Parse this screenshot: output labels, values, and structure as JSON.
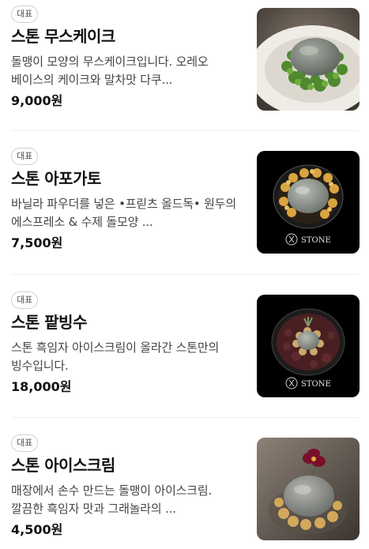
{
  "menu": {
    "items": [
      {
        "badge": "대표",
        "name": "스톤 무스케이크",
        "description": "돌맹이 모양의 무스케이크입니다. 오레오 베이스의 케이크와 말차맛 다쿠...",
        "price": "9,000원",
        "image_icon": "mousse-cake-photo"
      },
      {
        "badge": "대표",
        "name": "스톤 아포가토",
        "description": "바닐라 파우더를 넣은 •프릳츠 올드독• 원두의 에스프레소 & 수제 돌모양 ...",
        "price": "7,500원",
        "image_icon": "affogato-photo",
        "image_logo": "STONE"
      },
      {
        "badge": "대표",
        "name": "스톤 팥빙수",
        "description": "스톤 흑임자 아이스크림이 올라간 스톤만의 빙수입니다.",
        "price": "18,000원",
        "image_icon": "patbingsu-photo",
        "image_logo": "STONE"
      },
      {
        "badge": "대표",
        "name": "스톤 아이스크림",
        "description": "매장에서 손수 만드는 돌맹이 아이스크림. 깔끔한 흑임자 맛과 그래놀라의 ...",
        "price": "4,500원",
        "image_icon": "ice-cream-photo"
      }
    ]
  }
}
